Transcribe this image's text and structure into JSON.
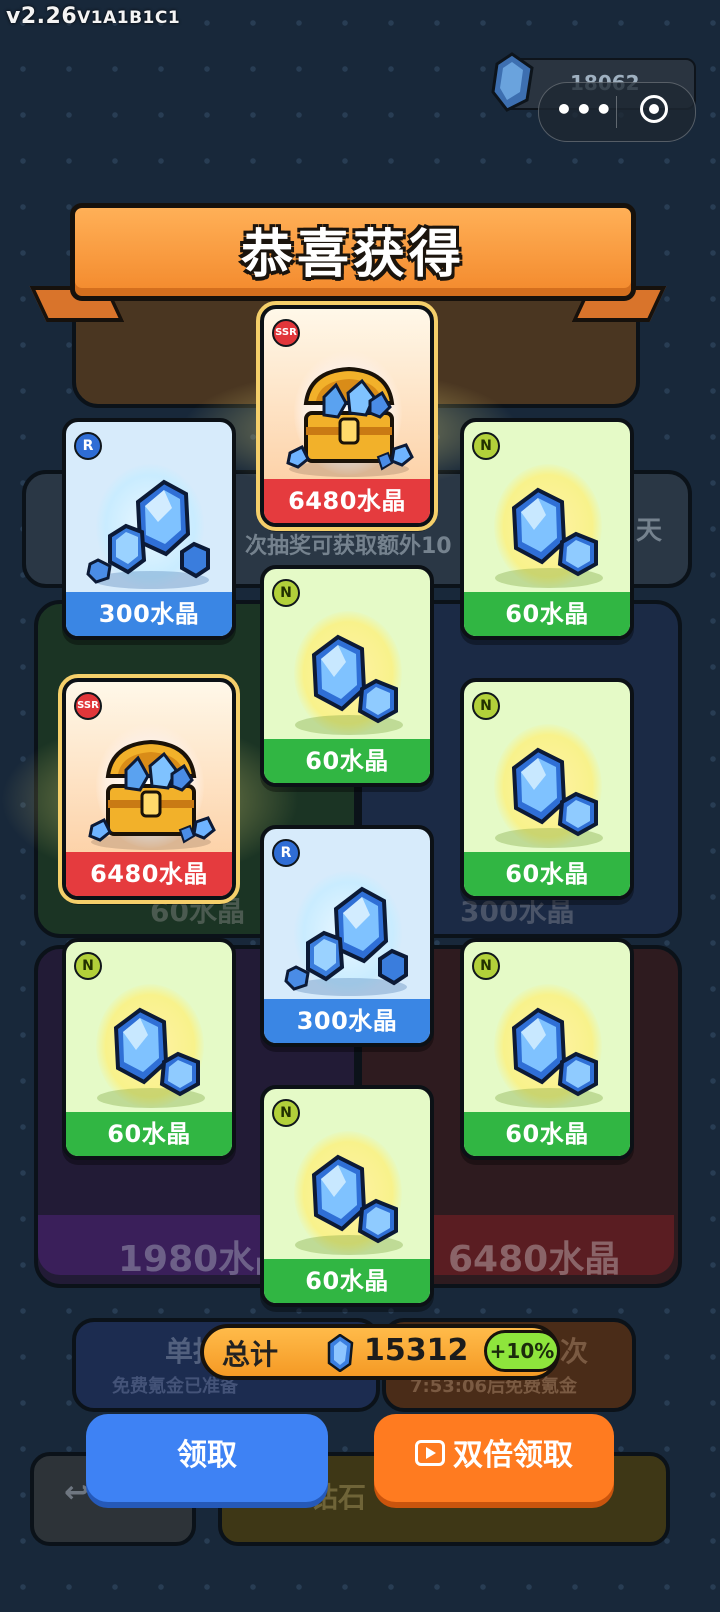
{
  "version": {
    "main": "v2.26",
    "build": "V1A1B1C1"
  },
  "currency": {
    "crystal_count": "18062"
  },
  "capsule": {
    "more_glyph": "•••"
  },
  "background": {
    "hint_text": "次抽奖可获取额外10",
    "day_text": "天",
    "green_price": "60水晶",
    "blue_price": "300水晶",
    "purple_price": "1980水晶",
    "red_price": "6480水晶",
    "single_title": "单抽",
    "single_sub": "免费氪金已准备",
    "multi_title": "次",
    "multi_sub": "7:53:06后免费氪金",
    "diamond_btn": "钻石",
    "back_arrow": "↩"
  },
  "banner": {
    "title": "恭喜获得"
  },
  "rewards": [
    {
      "rarity": "SSR",
      "label": "6480水晶"
    },
    {
      "rarity": "R",
      "label": "300水晶"
    },
    {
      "rarity": "N",
      "label": "60水晶"
    },
    {
      "rarity": "N",
      "label": "60水晶"
    },
    {
      "rarity": "SSR",
      "label": "6480水晶"
    },
    {
      "rarity": "N",
      "label": "60水晶"
    },
    {
      "rarity": "R",
      "label": "300水晶"
    },
    {
      "rarity": "N",
      "label": "60水晶"
    },
    {
      "rarity": "N",
      "label": "60水晶"
    },
    {
      "rarity": "N",
      "label": "60水晶"
    }
  ],
  "total": {
    "label": "总计",
    "value": "15312",
    "bonus": "+10%"
  },
  "buttons": {
    "claim": "领取",
    "double_claim": "双倍领取"
  },
  "colors": {
    "n_bar": "#31b643",
    "r_bar": "#3a86e4",
    "ssr_bar": "#e53b3e",
    "claim": "#3e82f4",
    "double_claim": "#ff7b20"
  },
  "icons": {
    "crystal": "blue-crystal-icon",
    "chest": "treasure-chest-icon",
    "video": "video-play-icon"
  }
}
